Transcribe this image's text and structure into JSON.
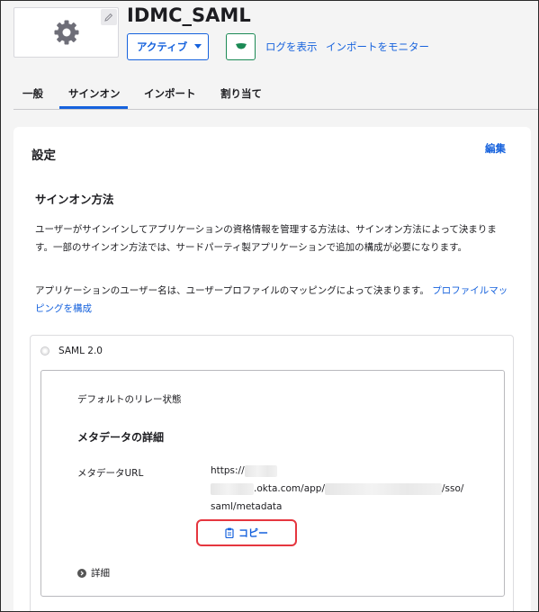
{
  "app": {
    "title": "IDMC_SAML",
    "status_label": "アクティブ",
    "view_logs": "ログを表示",
    "monitor_imports": "インポートをモニター"
  },
  "tabs": [
    {
      "label": "一般"
    },
    {
      "label": "サインオン",
      "active": true
    },
    {
      "label": "インポート"
    },
    {
      "label": "割り当て"
    }
  ],
  "settings": {
    "title": "設定",
    "edit_label": "編集",
    "section_title": "サインオン方法",
    "para1": "ユーザーがサインインしてアプリケーションの資格情報を管理する方法は、サインオン方法によって決まります。一部のサインオン方法では、サードパーティ製アプリケーションで追加の構成が必要になります。",
    "para2_text": "アプリケーションのユーザー名は、ユーザープロファイルのマッピングによって決まります。",
    "para2_link": "プロファイルマッピングを構成"
  },
  "saml": {
    "label": "SAML 2.0",
    "relay_state": "デフォルトのリレー状態",
    "metadata_title": "メタデータの詳細",
    "metadata_url_label": "メタデータURL",
    "url_part1": "https://",
    "url_part2": ".okta.com/app/",
    "url_part3": "/sso/",
    "url_part4": "saml/metadata",
    "copy_label": "コピー",
    "details_label": "詳細"
  },
  "colors": {
    "accent": "#1662dd",
    "push_green": "#1c8a55",
    "highlight_red": "#e5363f"
  },
  "icons": {
    "logo": "gear-icon",
    "edit": "pencil-icon",
    "status_caret": "caret-down-icon",
    "push": "push-icon",
    "copy": "clipboard-icon",
    "details": "chevron-right-icon"
  }
}
